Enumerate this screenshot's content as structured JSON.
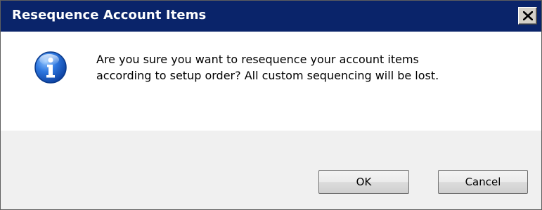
{
  "window": {
    "title": "Resequence Account Items",
    "close_icon": "close-icon"
  },
  "message": {
    "icon": "information-icon",
    "line1": "Are you sure you want to resequence your account items",
    "line2": "according to setup order? All custom sequencing will be lost."
  },
  "buttons": {
    "ok_label": "OK",
    "cancel_label": "Cancel"
  },
  "colors": {
    "titlebar": "#0a246a",
    "content_bg": "#ffffff",
    "footer_bg": "#f0f0f0",
    "icon_blue": "#1b5fc4"
  }
}
